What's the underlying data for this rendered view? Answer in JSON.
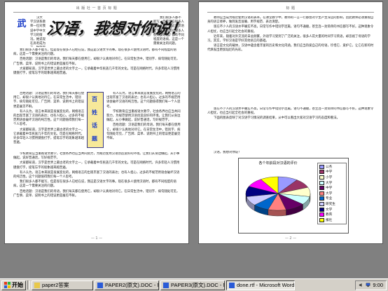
{
  "document": {
    "page_left": {
      "header": "出 版 社 一 首 页 标 题",
      "dropcap": "武",
      "wordart_title": "汉语，我想对你说！",
      "vertical_box_text": "百 姓 话 题",
      "intro": "汉大学汉语系教师一位对我说中学中文学习的情况，她说现在高考成为了一种题目类型，一个学生只要学好了，就好像一个人学到了无限的知识……",
      "paragraphs": [
        "我们很多人都不能写，但是现在很多人已经在说，我这是汉语文字的事。现在很多人使用汉语时，都有不同程度的语病，这是一个需要关注的问题。",
        "百姓话题：汉语是我们的母语，我们每天都在使用它，却很少认真地对待它。在日常生活中，错别字、病句随处可见，广告牌、菜单、说明书上的错误更是屡见不鲜。",
        "大家都知道，汉字是世界上最古老的文字之一，它承载着中华民族几千年的文化。可是在网络时代，许多年轻人习惯用键盘打字，提笔忘字的现象越来越普遍。",
        "有人认为，语言本来就是发展变化的，网络语言的出现丰富了汉语的表达；也有人担心，过多的不规范用语会破坏汉语的纯洁性。这个问题值得我们每一个人思考。",
        "学校教育应当重视语文教学，社会各界也应当共同努力，为规范使用汉语创造良好的环境。让我们从身边做起，从小事做起，说好普通话，写好规范字。"
      ],
      "footer": "— 1 —"
    },
    "page_right": {
      "header": "标 题",
      "paragraphs": [
        "教师应当成为规范使用汉语的表率。在课堂教学中，教师的一言一行都会对学生产生深远的影响，因此教师必须重视自身的语言修养，做到发音准确、用字规范、表达清楚。",
        "现在不少人的汉语水平确实不高，日常写作中错别字连篇，语句不通顺，甚至连一封简单的书信都写不好。这种现象令人担忧，也应当引起全社会的重视。",
        "近年来，随着对外交流的日益频繁，外语学习受到了广泛的关注，很多人花大量的时间学习英语，却忽视了母语的学习。其实，学好汉语是学好其他语言的基础。",
        "语言是文化的载体，汉语中蕴含着丰富的历史和文化内涵。我们应当热爱自己的母语，珍惜它、爱护它，让它在新的时代焕发出更加灿烂的光彩。",
        "下面的图表反映了对汉语学习情况的调查结果，从中可以看出大家对汉语学习的态度和看法。"
      ],
      "closing": "汉语，我想对你说！",
      "footer": "— 2 —"
    }
  },
  "chart_data": {
    "type": "pie",
    "title": "各个年龄段对汉语的评价",
    "categories": [
      "公务",
      "中学",
      "小学",
      "大学",
      "中学",
      "大学",
      "专业",
      "研究生",
      "文学",
      "教育",
      "报社"
    ],
    "values": [
      10,
      9,
      9,
      8,
      10,
      9,
      8,
      9,
      10,
      9,
      9
    ],
    "legend_position": "right",
    "colors": [
      "#9999ff",
      "#993366",
      "#ffffcc",
      "#ccffff",
      "#660066",
      "#ff8080",
      "#0066cc",
      "#ccccff",
      "#000080",
      "#ff00ff",
      "#ffff00"
    ]
  },
  "taskbar": {
    "start_label": "开始",
    "buttons": [
      {
        "label": "paper2答案",
        "icon_color": "#e8c84a",
        "active": false
      },
      {
        "label": "PAPER2(原文).DOC - M...",
        "icon_color": "#2a5bd7",
        "active": false
      },
      {
        "label": "PAPER3(原文).DOC - M...",
        "icon_color": "#2a5bd7",
        "active": false
      },
      {
        "label": "done.rtf - Microsoft Word",
        "icon_color": "#2a5bd7",
        "active": true
      }
    ],
    "clock": "9:00"
  }
}
